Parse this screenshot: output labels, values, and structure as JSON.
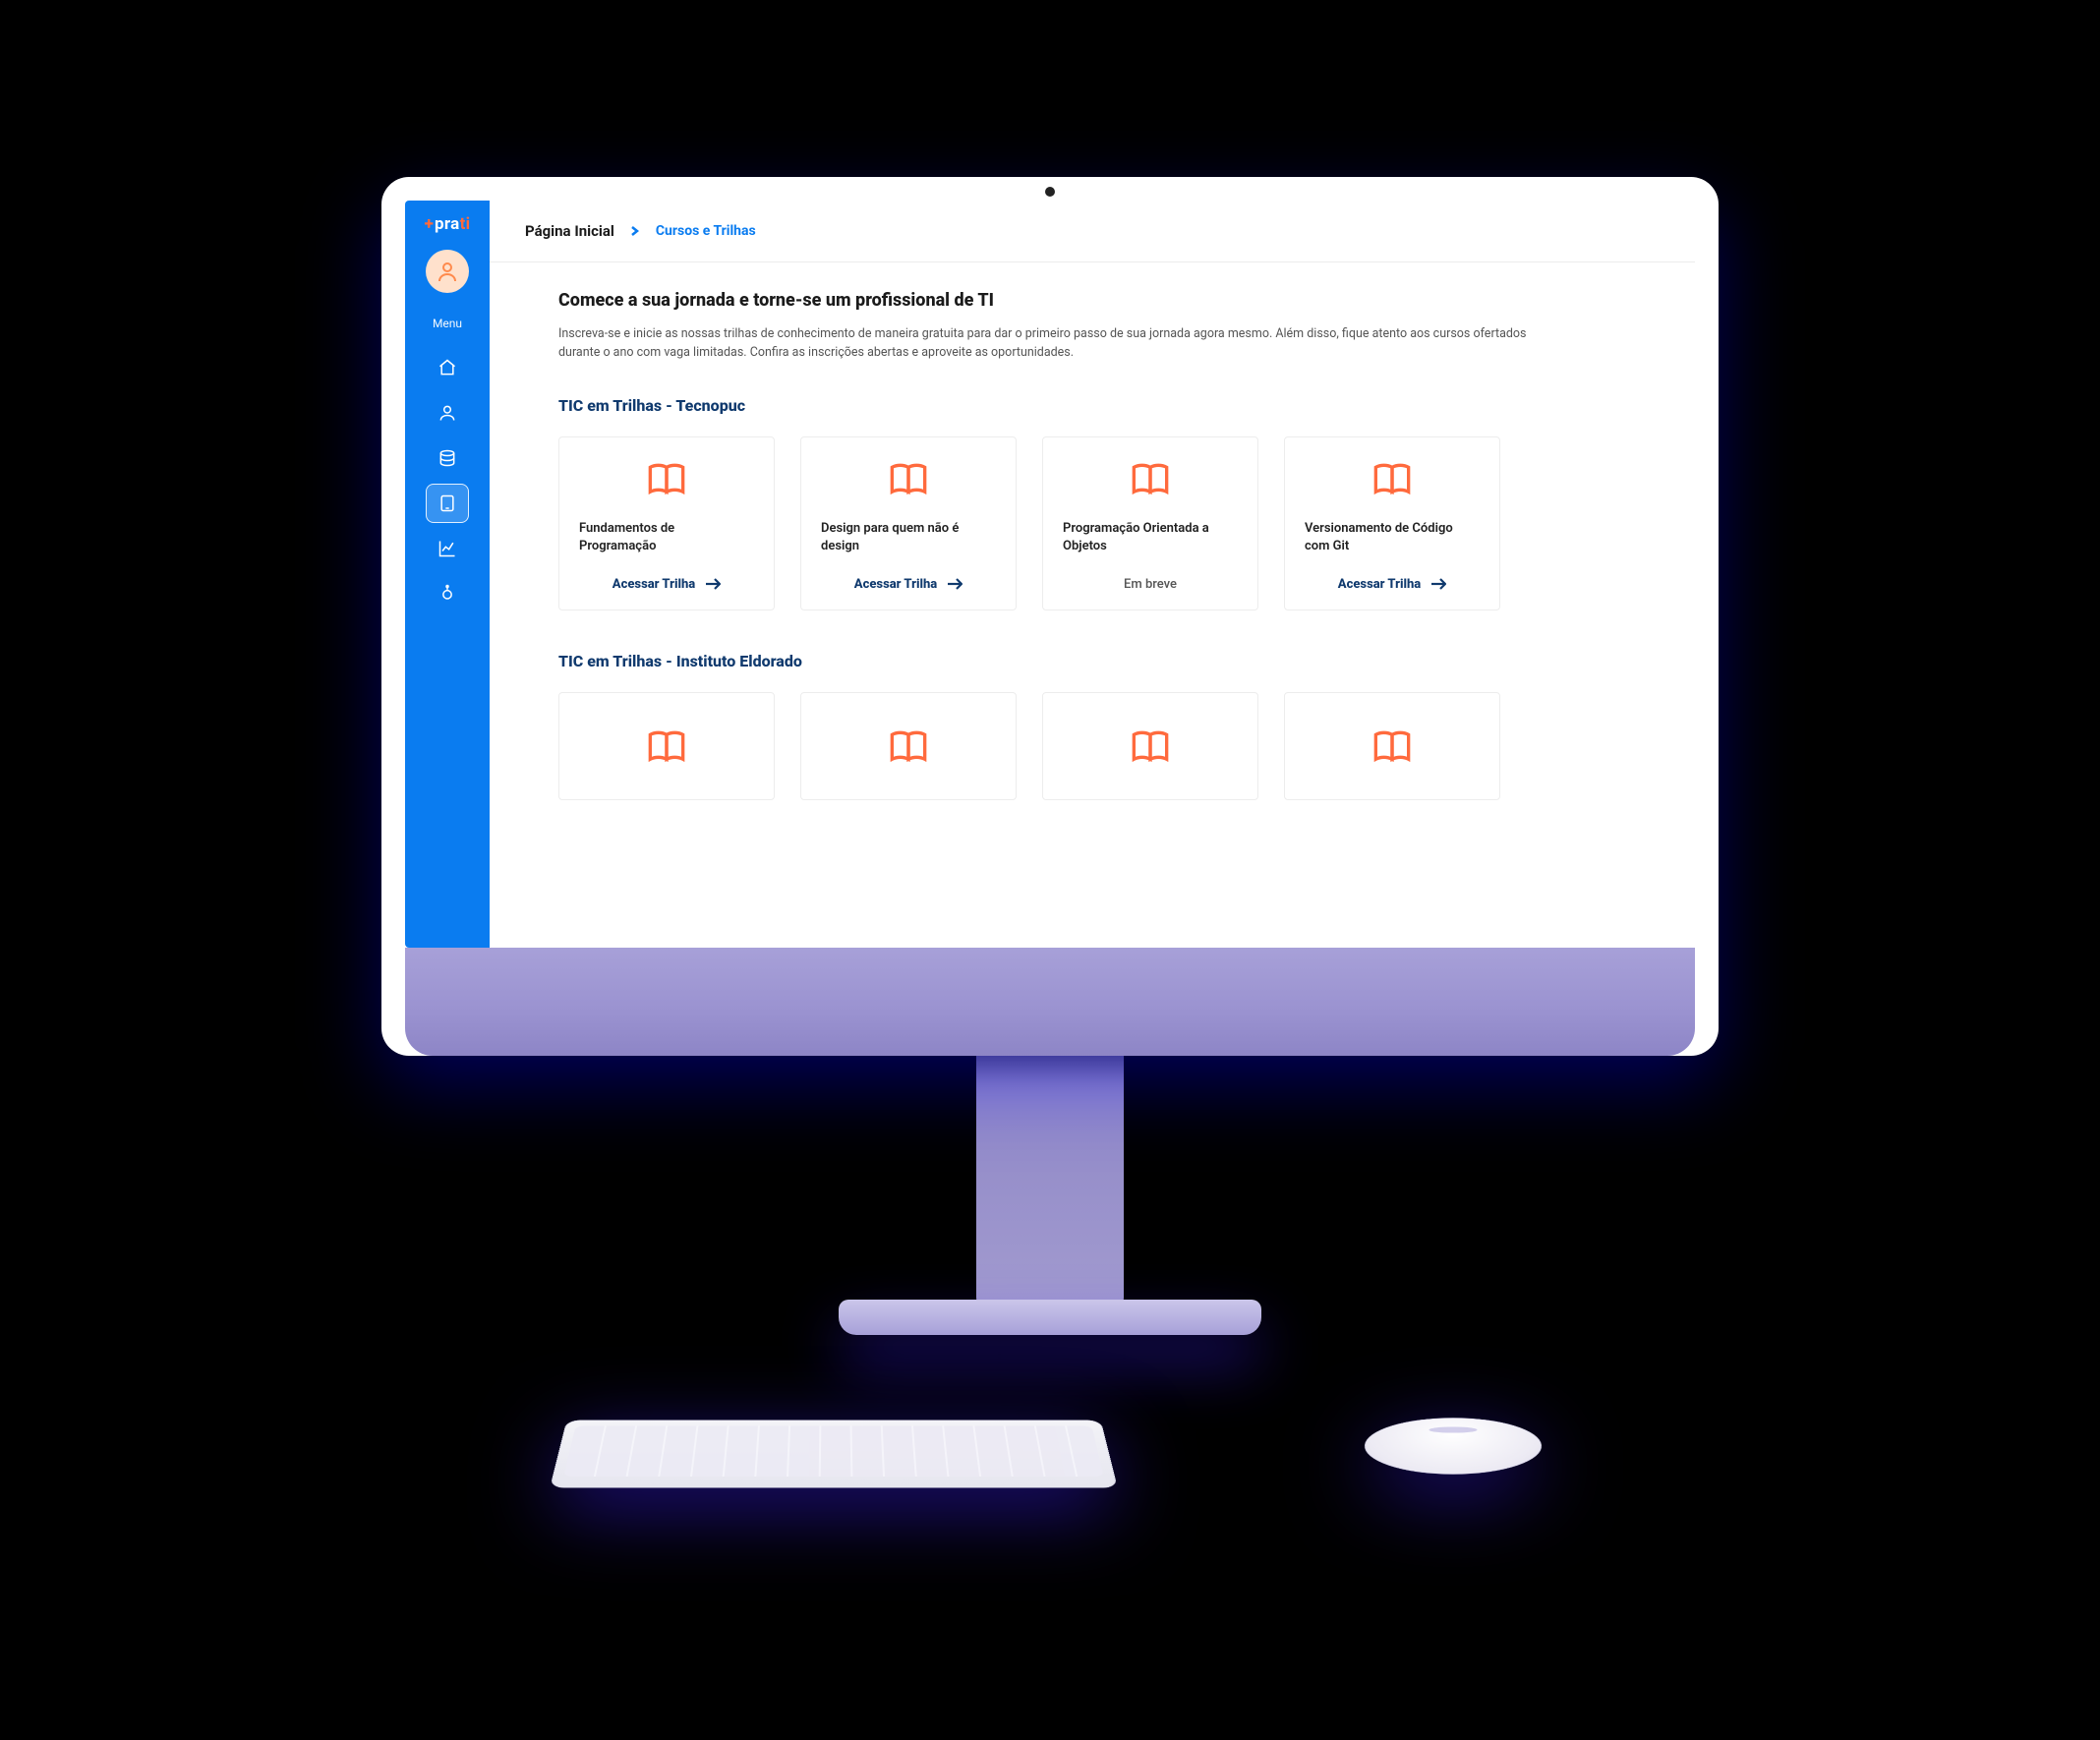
{
  "brand": {
    "plus": "+",
    "pra": "pra",
    "ti": "ti"
  },
  "sidebar": {
    "menu_label": "Menu",
    "items": [
      {
        "name": "home",
        "icon": "home-icon"
      },
      {
        "name": "profile",
        "icon": "user-icon"
      },
      {
        "name": "database",
        "icon": "database-icon"
      },
      {
        "name": "courses",
        "icon": "tablet-icon",
        "active": true
      },
      {
        "name": "analytics",
        "icon": "chart-icon"
      },
      {
        "name": "extra",
        "icon": "sparkle-icon"
      }
    ]
  },
  "breadcrumb": {
    "root": "Página Inicial",
    "current": "Cursos e Trilhas"
  },
  "hero": {
    "headline": "Comece a sua jornada e torne-se um profissional de TI",
    "intro": "Inscreva-se e inicie as nossas trilhas de conhecimento de maneira gratuita para dar o primeiro passo de sua jornada agora mesmo. Além disso, fique atento aos cursos ofertados durante o ano com vaga limitadas. Confira as inscrições abertas e aproveite as oportunidades."
  },
  "labels": {
    "access": "Acessar Trilha",
    "soon": "Em breve"
  },
  "sections": [
    {
      "title": "TIC em Trilhas - Tecnopuc",
      "cards": [
        {
          "title": "Fundamentos de Programação",
          "action": "access"
        },
        {
          "title": "Design para quem não é design",
          "action": "access"
        },
        {
          "title": "Programação Orientada a Objetos",
          "action": "soon"
        },
        {
          "title": "Versionamento de Código com Git",
          "action": "access"
        }
      ]
    },
    {
      "title": "TIC em Trilhas - Instituto Eldorado",
      "cards": [
        {
          "title": "",
          "action": ""
        },
        {
          "title": "",
          "action": ""
        },
        {
          "title": "",
          "action": ""
        },
        {
          "title": "",
          "action": ""
        }
      ],
      "icon_only": true
    }
  ],
  "colors": {
    "primary": "#0a7cf0",
    "accent": "#ff6a3d",
    "navy": "#103a6e"
  }
}
